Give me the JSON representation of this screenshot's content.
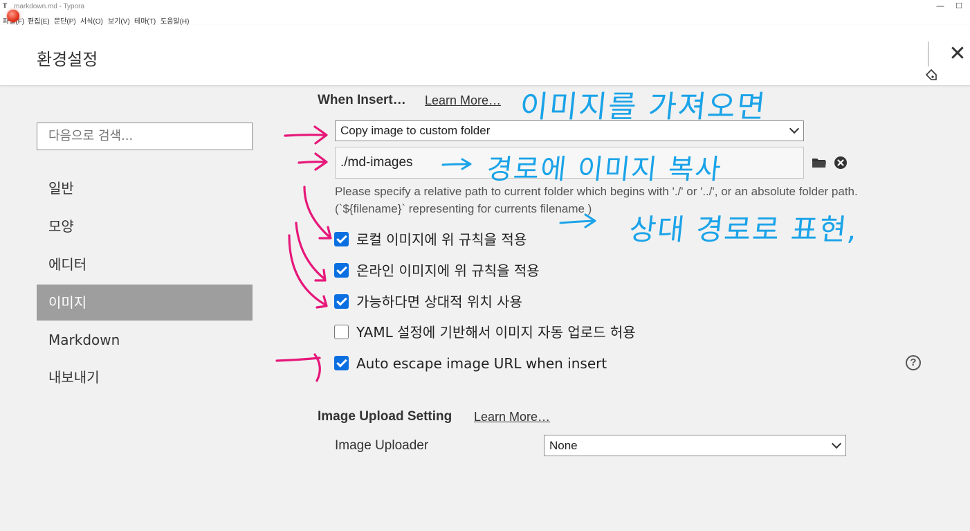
{
  "window": {
    "title": "markdown.md - Typora",
    "minimize_glyph": "—",
    "maximize_glyph": "☐"
  },
  "menu": [
    "파일(F)",
    "편집(E)",
    "문단(P)",
    "서식(O)",
    "보기(V)",
    "테마(T)",
    "도움말(H)"
  ],
  "prefs": {
    "title": "환경설정",
    "close_glyph": "✕"
  },
  "sidebar": {
    "search_placeholder": "다음으로 검색...",
    "items": [
      {
        "label": "일반",
        "active": false
      },
      {
        "label": "모양",
        "active": false
      },
      {
        "label": "에디터",
        "active": false
      },
      {
        "label": "이미지",
        "active": true
      },
      {
        "label": "Markdown",
        "active": false
      },
      {
        "label": "내보내기",
        "active": false
      }
    ]
  },
  "when_insert": {
    "heading": "When Insert…",
    "learn_more": "Learn More…",
    "action_select": "Copy image to custom folder",
    "path_value": "./md-images",
    "help_text": "Please specify a relative path to current folder which begins with './' or '../', or an absolute folder path. (`${filename}` representing for currents filename )",
    "options": [
      {
        "label": "로컬 이미지에 위 규칙을 적용",
        "checked": true
      },
      {
        "label": "온라인 이미지에 위 규칙을 적용",
        "checked": true
      },
      {
        "label": "가능하다면 상대적 위치 사용",
        "checked": true
      },
      {
        "label": "YAML 설정에 기반해서 이미지 자동 업로드 허용",
        "checked": false
      },
      {
        "label": "Auto escape image URL when insert",
        "checked": true
      }
    ],
    "help_glyph": "?"
  },
  "upload": {
    "heading": "Image Upload Setting",
    "learn_more": "Learn More…",
    "uploader_label": "Image Uploader",
    "uploader_value": "None"
  },
  "annotations": {
    "note1": "이미지를 가져오면",
    "note2": "경로에 이미지 복사",
    "note3": "상대 경로로 표현,",
    "arrow_color": "#e6187a",
    "text_color": "#1aa3e8"
  },
  "colors": {
    "checkbox_on": "#0a6fe0",
    "active_nav": "#9e9e9e"
  }
}
